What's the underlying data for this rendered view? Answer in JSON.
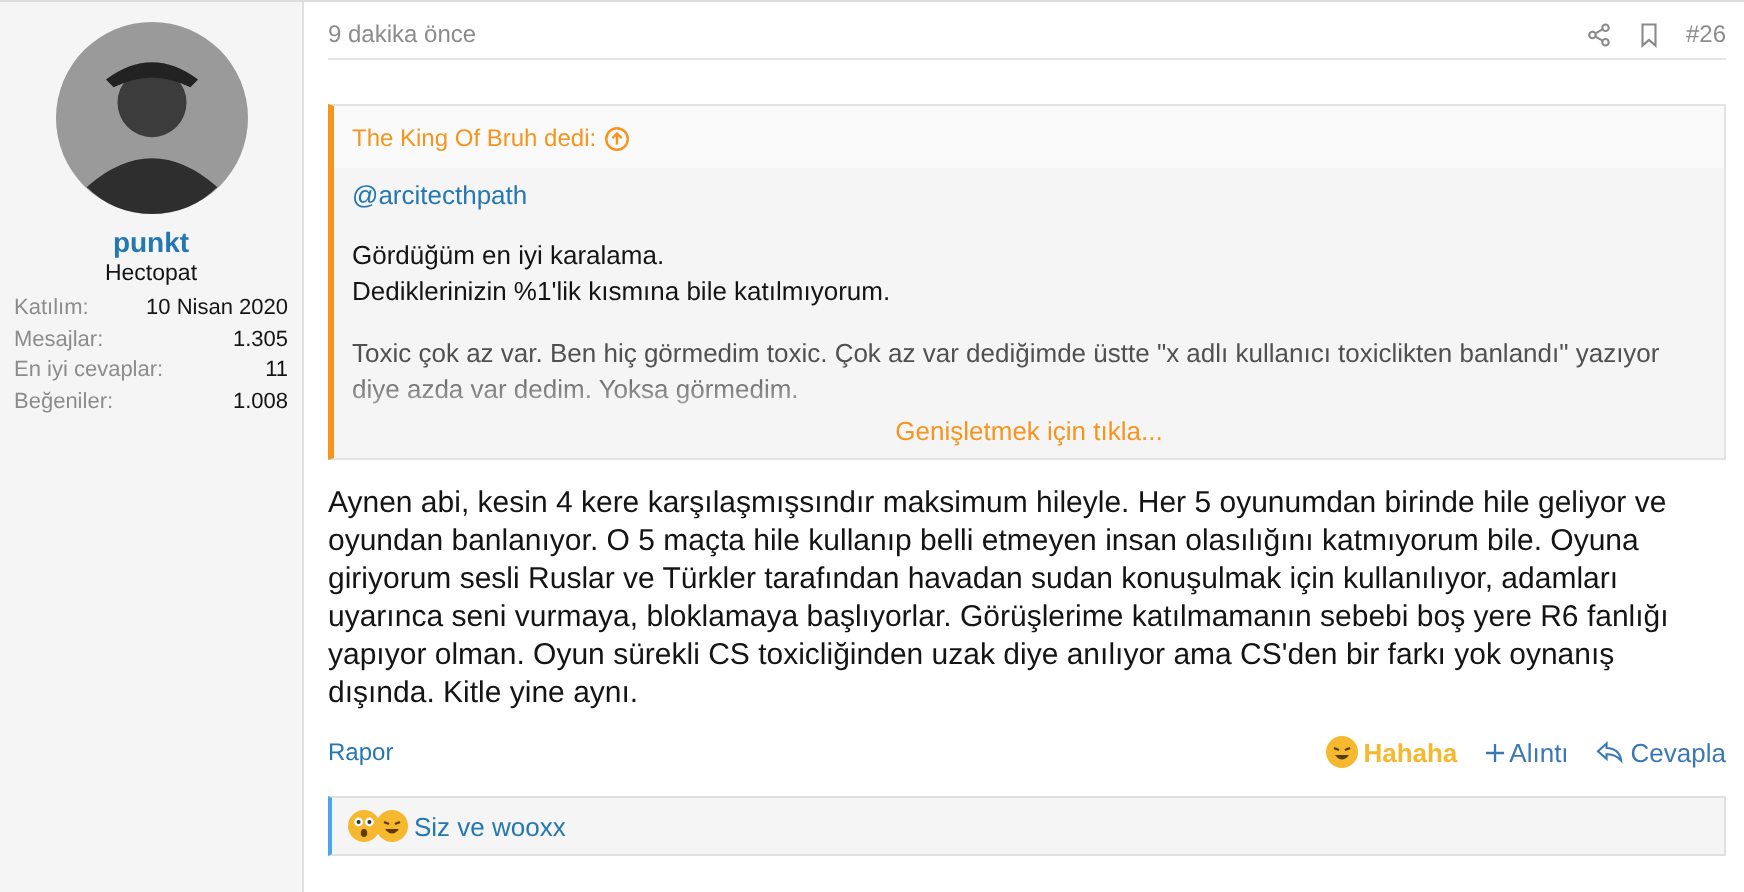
{
  "author": {
    "name": "punkt",
    "title": "Hectopat",
    "stats": [
      {
        "label": "Katılım:",
        "value": "10 Nisan 2020"
      },
      {
        "label": "Mesajlar:",
        "value": "1.305"
      },
      {
        "label": "En iyi cevaplar:",
        "value": "11"
      },
      {
        "label": "Beğeniler:",
        "value": "1.008"
      }
    ]
  },
  "post": {
    "time": "9 dakika önce",
    "number": "#26",
    "quote": {
      "attribution": "The King Of Bruh dedi:",
      "mention": "@arcitecthpath",
      "paragraphs": [
        "Gördüğüm en iyi karalama.\nDediklerinizin %1'lik kısmına bile katılmıyorum.",
        "Toxic çok az var. Ben hiç görmedim toxic. Çok az var dediğimde üstte \"x adlı kullanıcı toxiclikten banlandı\" yazıyor diye azda var dedim. Yoksa görmedim."
      ],
      "expand": "Genişletmek için tıkla..."
    },
    "body": "Aynen abi, kesin 4 kere karşılaşmışsındır maksimum hileyle. Her 5 oyunumdan birinde hile geliyor ve oyundan banlanıyor. O 5 maçta hile kullanıp belli etmeyen insan olasılığını katmıyorum bile. Oyuna giriyorum sesli Ruslar ve Türkler tarafından havadan sudan konuşulmak için kullanılıyor, adamları uyarınca seni vurmaya, bloklamaya başlıyorlar. Görüşlerime katılmamanın sebebi boş yere R6 fanlığı yapıyor olman. Oyun sürekli CS toxicliğinden uzak diye anılıyor ama CS'den bir farkı yok oynanış dışında. Kitle yine aynı.",
    "report": "Rapor",
    "actions": [
      {
        "kind": "reaction",
        "label": "Hahaha",
        "selected": true
      },
      {
        "kind": "quote",
        "label": "Alıntı"
      },
      {
        "kind": "reply",
        "label": "Cevapla"
      }
    ],
    "reactions_summary": "Siz ve wooxx"
  }
}
